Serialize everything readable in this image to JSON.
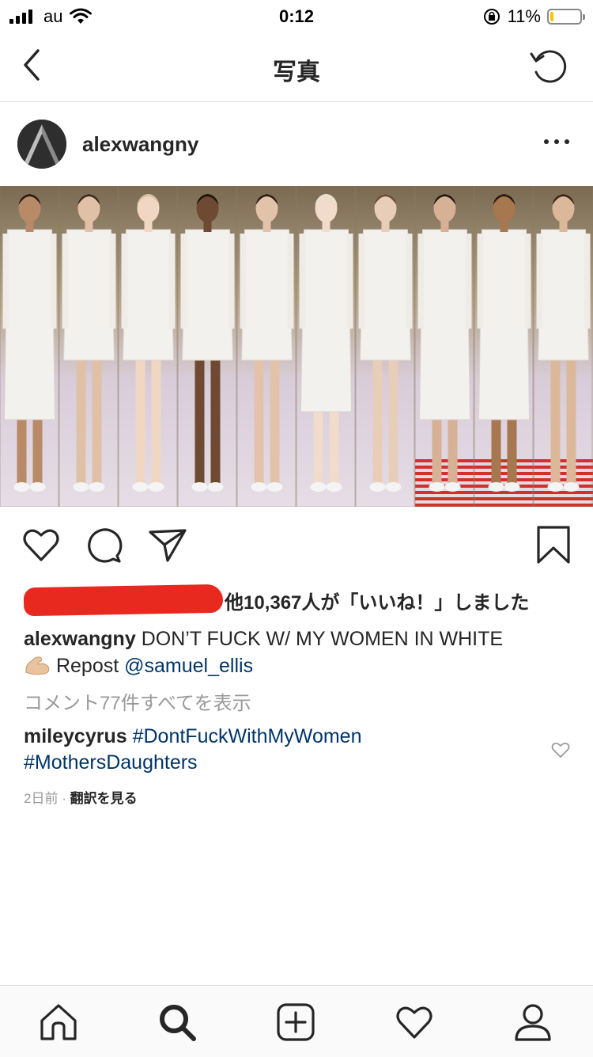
{
  "status_bar": {
    "carrier": "au",
    "time": "0:12",
    "battery_text": "11%",
    "battery_level": 0.11,
    "battery_color": "#f5c400"
  },
  "nav": {
    "title": "写真",
    "back_icon": "chevron-left-icon",
    "refresh_icon": "refresh-icon"
  },
  "post": {
    "username": "alexwangny",
    "more_icon": "more-dots-icon",
    "photo_alt": "runway models in white outfits",
    "likes": {
      "text": "他10,367人が「いいね！」しました"
    },
    "caption": {
      "username": "alexwangny",
      "text": "DON’T FUCK W/ MY WOMEN IN WHITE",
      "repost_label": "Repost",
      "repost_handle": "@samuel_ellis"
    },
    "view_comments": "コメント77件すべてを表示",
    "comment": {
      "username": "mileycyrus",
      "hashtag1": "#DontFuckWithMyWomen",
      "hashtag2": "#MothersDaughters"
    },
    "timestamp": "2日前",
    "separator": " · ",
    "translate": "翻訳を見る"
  },
  "colors": {
    "link": "#003569",
    "muted": "#999999",
    "text": "#262626",
    "redaction": "#e8291f"
  },
  "tabs": [
    "home-icon",
    "search-icon",
    "add-post-icon",
    "activity-heart-icon",
    "profile-icon"
  ]
}
